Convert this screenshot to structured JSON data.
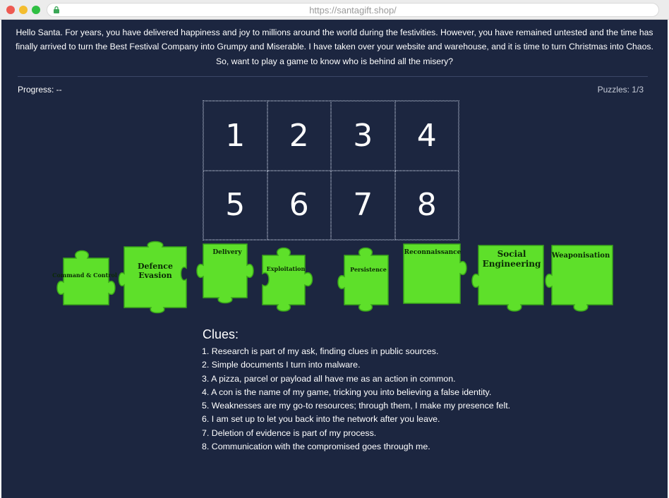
{
  "browser": {
    "url": "https://santagift.shop/",
    "lock_icon": "lock-icon",
    "window_buttons": [
      "close",
      "minimize",
      "zoom"
    ]
  },
  "intro": {
    "paragraph": "Hello Santa. For years, you have delivered happiness and joy to millions around the world during the festivities. However, you have remained untested and the time has finally arrived to turn the Best Festival Company into Grumpy and Miserable. I have taken over your website and warehouse, and it is time to turn Christmas into Chaos.",
    "question": "So, want to play a game to know who is behind all the misery?"
  },
  "status": {
    "progress": "Progress: --",
    "puzzles": "Puzzles: 1/3"
  },
  "grid": {
    "slots": [
      "1",
      "2",
      "3",
      "4",
      "5",
      "6",
      "7",
      "8"
    ]
  },
  "pieces": [
    {
      "label": "Command & Control",
      "color": "#5ee02a"
    },
    {
      "label": "Defence Evasion",
      "color": "#5ee02a"
    },
    {
      "label": "Delivery",
      "color": "#5ee02a"
    },
    {
      "label": "Exploitation",
      "color": "#5ee02a"
    },
    {
      "label": "Persistence",
      "color": "#5ee02a"
    },
    {
      "label": "Reconnaissance",
      "color": "#5ee02a"
    },
    {
      "label": "Social Engineering",
      "color": "#5ee02a"
    },
    {
      "label": "Weaponisation",
      "color": "#5ee02a"
    }
  ],
  "clues": {
    "title": "Clues:",
    "items": [
      "1. Research is part of my ask, finding clues in public sources.",
      "2. Simple documents I turn into malware.",
      "3. A pizza, parcel or payload all have me as an action in common.",
      "4. A con is the name of my game, tricking you into believing a false identity.",
      "5. Weaknesses are my go-to resources; through them, I make my presence felt.",
      "6. I am set up to let you back into the network after you leave.",
      "7. Deletion of evidence is part of my process.",
      "8. Communication with the compromised goes through me."
    ]
  },
  "colors": {
    "page_background": "#1c2640",
    "piece_green": "#5ee02a",
    "text": "#ffffff"
  }
}
